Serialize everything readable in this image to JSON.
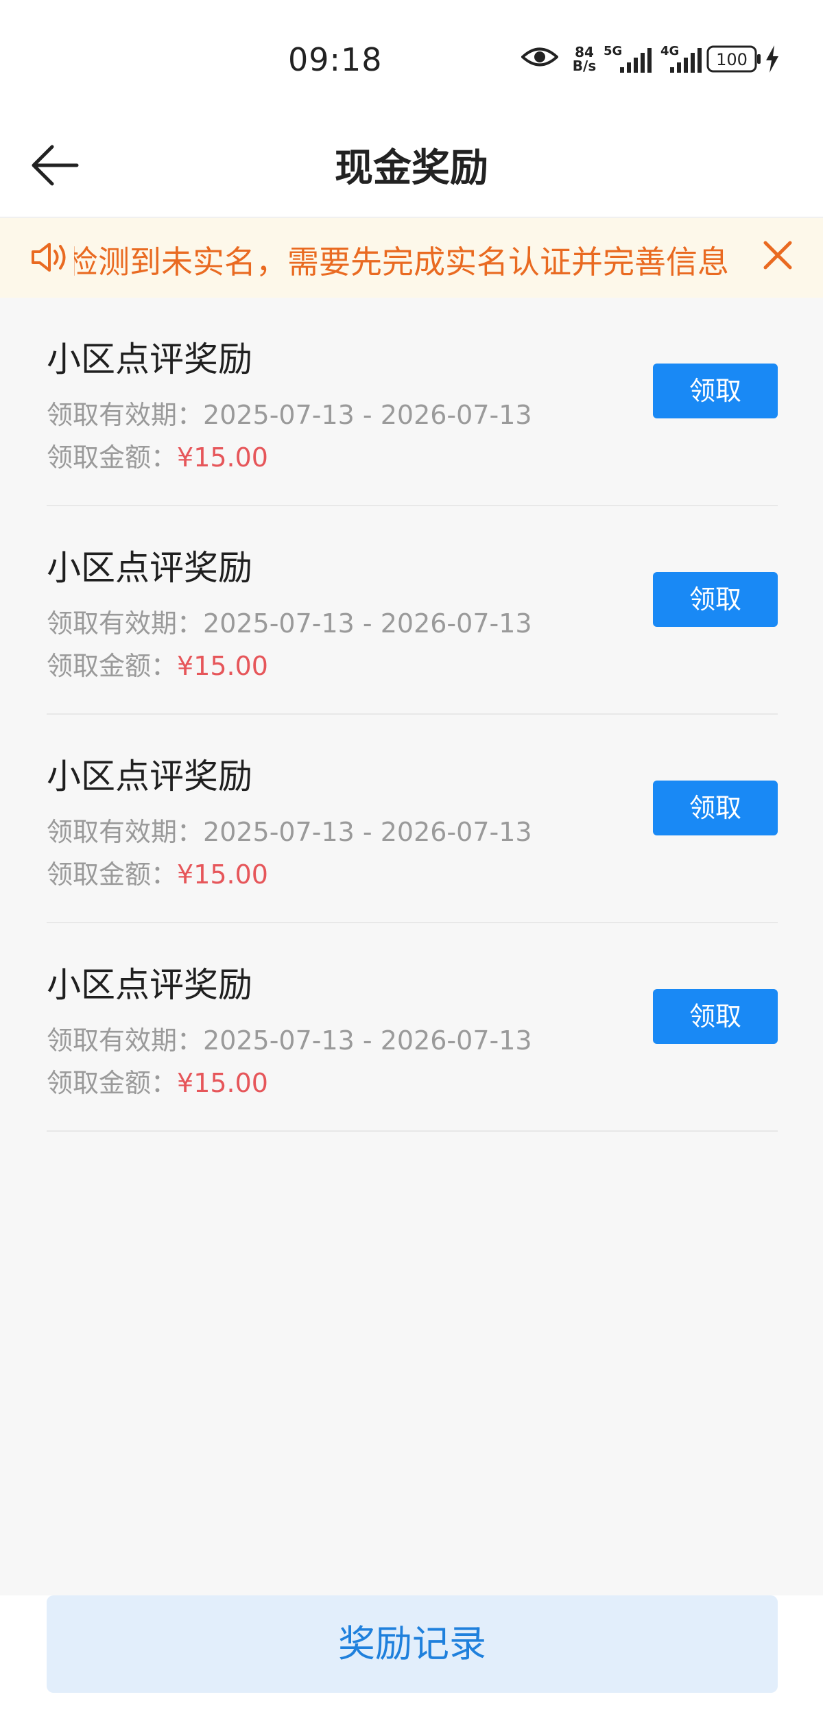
{
  "status_bar": {
    "time": "09:18",
    "net_speed_value": "84",
    "net_speed_unit": "B/s",
    "signal_1": "5G",
    "signal_2": "4G",
    "battery": "100",
    "icons": [
      "eye-icon",
      "signal-5g-icon",
      "signal-4g-icon",
      "battery-icon",
      "charging-icon"
    ]
  },
  "header": {
    "title": "现金奖励",
    "back_icon": "arrow-left-icon"
  },
  "notice": {
    "text": "检测到未实名，需要先完成实名认证并完善信息",
    "icon": "speaker-icon",
    "close_icon": "close-icon"
  },
  "rewards": [
    {
      "title": "小区点评奖励",
      "period_label": "领取有效期：",
      "period": "2025-07-13 - 2026-07-13",
      "amount_label": "领取金额：",
      "amount": "¥15.00",
      "button": "领取"
    },
    {
      "title": "小区点评奖励",
      "period_label": "领取有效期：",
      "period": "2025-07-13 - 2026-07-13",
      "amount_label": "领取金额：",
      "amount": "¥15.00",
      "button": "领取"
    },
    {
      "title": "小区点评奖励",
      "period_label": "领取有效期：",
      "period": "2025-07-13 - 2026-07-13",
      "amount_label": "领取金额：",
      "amount": "¥15.00",
      "button": "领取"
    },
    {
      "title": "小区点评奖励",
      "period_label": "领取有效期：",
      "period": "2025-07-13 - 2026-07-13",
      "amount_label": "领取金额：",
      "amount": "¥15.00",
      "button": "领取"
    }
  ],
  "footer": {
    "records_button": "奖励记录"
  },
  "colors": {
    "accent": "#1989f5",
    "amount": "#e6565a",
    "notice_text": "#e96a21",
    "notice_bg": "#fdf8ea"
  }
}
